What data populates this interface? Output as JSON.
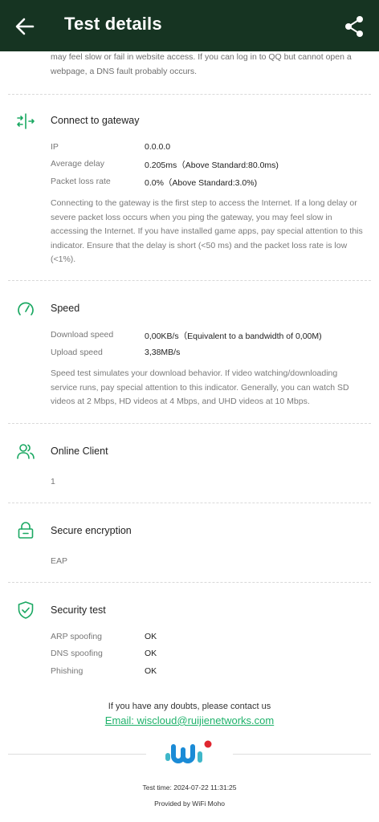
{
  "header": {
    "title": "Test details",
    "back_icon": "arrow-left-icon",
    "share_icon": "share-icon",
    "background": "#163422"
  },
  "intro_text": "may feel slow or fail in website access. If you can log in to QQ but cannot open a webpage, a DNS fault probably occurs.",
  "gateway": {
    "title": "Connect to gateway",
    "icon": "gateway-icon",
    "rows": [
      {
        "key": "IP",
        "value": "0.0.0.0"
      },
      {
        "key": "Average delay",
        "value": "0.205ms（Above Standard:80.0ms)"
      },
      {
        "key": "Packet loss rate",
        "value": "0.0%（Above Standard:3.0%)"
      }
    ],
    "description": "Connecting to the gateway is the first step to access the Internet. If a long delay or severe packet loss occurs when you ping the gateway, you may feel slow in accessing the Internet. If you have installed game apps, pay special attention to this indicator. Ensure that the delay is short (<50 ms) and the packet loss rate is low (<1%)."
  },
  "speed": {
    "title": "Speed",
    "icon": "speedometer-icon",
    "rows": [
      {
        "key": "Download speed",
        "value": "0,00KB/s（Equivalent to a bandwidth of 0,00M)"
      },
      {
        "key": "Upload speed",
        "value": "3,38MB/s"
      }
    ],
    "description": "Speed test simulates your download behavior. If video watching/downloading service runs, pay special attention to this indicator. Generally, you can watch SD videos at 2 Mbps, HD videos at 4 Mbps, and UHD videos at 10 Mbps."
  },
  "online_client": {
    "title": "Online Client",
    "icon": "users-icon",
    "value": "1"
  },
  "encryption": {
    "title": "Secure encryption",
    "icon": "lock-icon",
    "value": "EAP"
  },
  "security": {
    "title": "Security test",
    "icon": "shield-check-icon",
    "rows": [
      {
        "key": "ARP spoofing",
        "value": "OK"
      },
      {
        "key": "DNS spoofing",
        "value": "OK"
      },
      {
        "key": "Phishing",
        "value": "OK"
      }
    ]
  },
  "footer": {
    "contact_text": "If you have any doubts, please contact us",
    "email_text": "Email: wiscloud@ruijienetworks.com",
    "logo_icon": "wifi-moho-logo",
    "test_time": "Test time: 2024-07-22 11:31:25",
    "provided_by": "Provided by WiFi Moho"
  },
  "colors": {
    "accent": "#1fb26b",
    "icon_green": "#1aa862",
    "logo_blue": "#1b8bd6",
    "logo_red": "#e0262f"
  }
}
